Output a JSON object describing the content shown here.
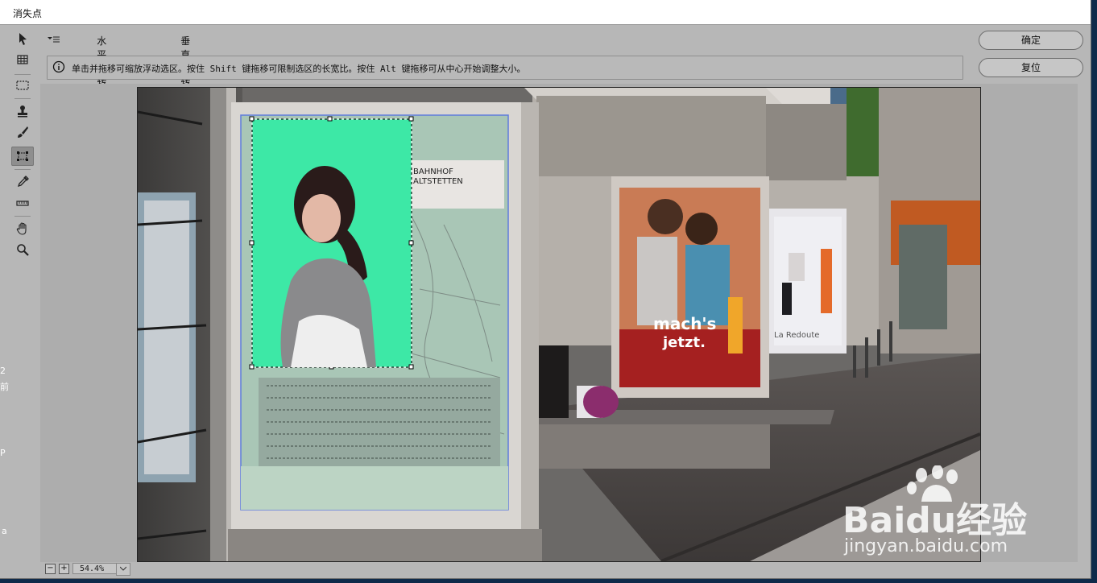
{
  "window": {
    "title": "消失点"
  },
  "tools": [
    {
      "name": "edit-plane-tool"
    },
    {
      "name": "create-plane-tool"
    },
    {
      "name": "marquee-tool"
    },
    {
      "name": "stamp-tool"
    },
    {
      "name": "brush-tool"
    },
    {
      "name": "transform-tool"
    },
    {
      "name": "eyedropper-tool"
    },
    {
      "name": "measure-tool"
    },
    {
      "name": "hand-tool"
    },
    {
      "name": "zoom-tool"
    }
  ],
  "options": {
    "flip_horizontal": "水平翻转",
    "flip_vertical": "垂直翻转"
  },
  "info": {
    "text": "单击并拖移可缩放浮动选区。按住 Shift 键拖移可限制选区的长宽比。按住 Alt 键拖移可从中心开始调整大小。"
  },
  "buttons": {
    "ok": "确定",
    "reset": "复位"
  },
  "zoom": {
    "value": "54.4%",
    "minus": "−",
    "plus": "+"
  },
  "photo": {
    "poster_title_1": "BAHNHOF",
    "poster_title_2": "ALTSTETTEN",
    "ad_text_1": "mach's",
    "ad_text_2": "jetzt.",
    "ad_brand": "La Redoute"
  },
  "watermark": {
    "main": "Baidu经验",
    "sub": "jingyan.baidu.com"
  },
  "left_strip": {
    "chars": [
      "2",
      "前",
      "P",
      "a"
    ]
  },
  "colors": {
    "selection_fill": "#3de8a6",
    "dialog_bg": "#b7b7b7"
  }
}
